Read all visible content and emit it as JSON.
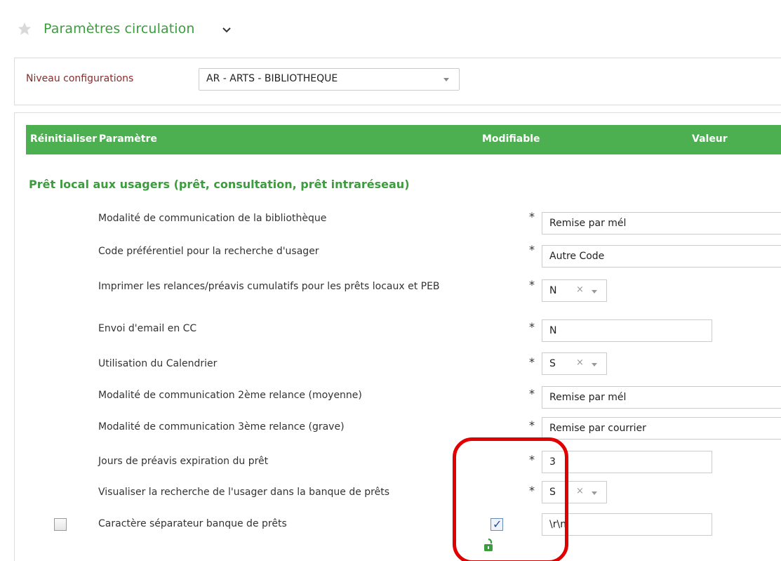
{
  "header": {
    "title": "Paramètres circulation"
  },
  "niveau": {
    "label": "Niveau configurations",
    "selected": "AR - ARTS - BIBLIOTHEQUE"
  },
  "grid": {
    "columns": {
      "reset": "Réinitialiser",
      "param": "Paramètre",
      "modifiable": "Modifiable",
      "value": "Valeur"
    },
    "section": "Prêt local aux usagers (prêt, consultation, prêt intraréseau)",
    "required_mark": "*",
    "clear_mark": "×",
    "rows": [
      {
        "label": "Modalité de communication de la bibliothèque",
        "value": "Remise par mél"
      },
      {
        "label": "Code préférentiel pour la recherche d'usager",
        "value": "Autre Code"
      },
      {
        "label": "Imprimer les relances/préavis cumulatifs pour les prêts locaux et PEB",
        "value": "N"
      },
      {
        "label": "Envoi d'email en CC",
        "value": "N"
      },
      {
        "label": "Utilisation du Calendrier",
        "value": "S"
      },
      {
        "label": "Modalité de communication 2ème relance (moyenne)",
        "value": "Remise par mél"
      },
      {
        "label": "Modalité de communication 3ème relance (grave)",
        "value": "Remise par courrier"
      },
      {
        "label": "Jours de préavis expiration du prêt",
        "value": "3"
      },
      {
        "label": "Visualiser la recherche de l'usager dans la banque de prêts",
        "value": "S"
      },
      {
        "label": "Caractère séparateur banque de prêts",
        "value": "\\r\\n",
        "reset_checked": false,
        "modifiable_checked": true
      }
    ]
  },
  "colors": {
    "accent": "#4caf50",
    "title": "#3c9c3e",
    "highlight": "#e00000"
  }
}
